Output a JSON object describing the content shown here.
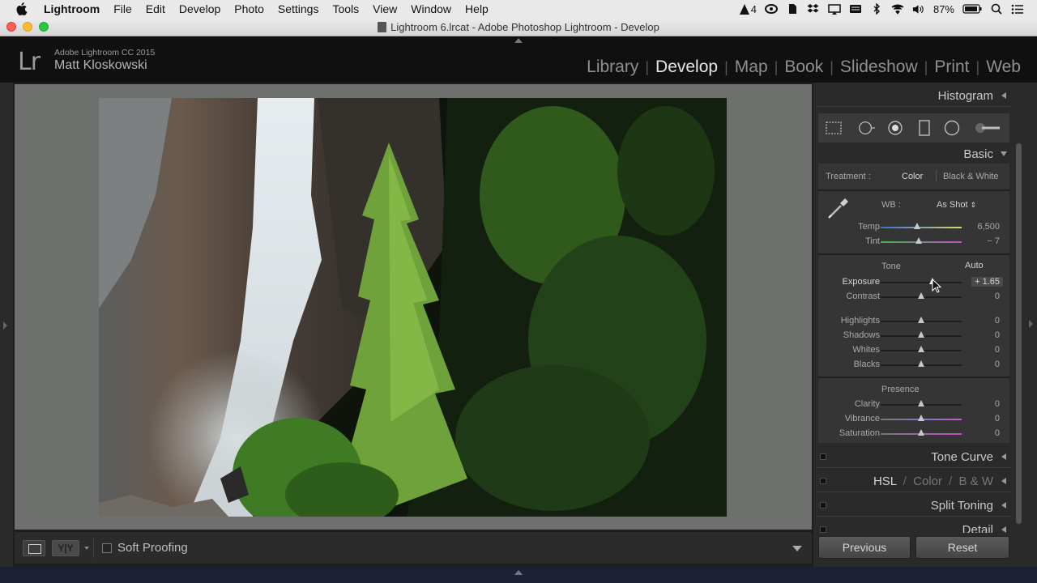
{
  "menubar": {
    "app_name": "Lightroom",
    "items": [
      "File",
      "Edit",
      "Develop",
      "Photo",
      "Settings",
      "Tools",
      "View",
      "Window",
      "Help"
    ],
    "status": {
      "badge_count": "4",
      "battery": "87%",
      "icons": [
        "adobe-cc-icon",
        "creative-cloud-icon",
        "evernote-icon",
        "dropbox-icon",
        "airplay-icon",
        "keyboard-icon",
        "bluetooth-icon",
        "wifi-icon",
        "volume-icon",
        "battery-icon",
        "spotlight-icon",
        "notification-center-icon"
      ]
    }
  },
  "window": {
    "title": "Lightroom 6.lrcat - Adobe Photoshop Lightroom - Develop"
  },
  "identity": {
    "logo": "Lr",
    "product": "Adobe Lightroom CC 2015",
    "user": "Matt Kloskowski"
  },
  "modules": {
    "items": [
      "Library",
      "Develop",
      "Map",
      "Book",
      "Slideshow",
      "Print",
      "Web"
    ],
    "active": "Develop"
  },
  "toolbar": {
    "soft_proofing_label": "Soft Proofing",
    "yy_label": "Y|Y"
  },
  "panels": {
    "histogram": "Histogram",
    "basic": "Basic",
    "tone_curve": "Tone Curve",
    "hsl": {
      "hsl": "HSL",
      "color": "Color",
      "bw": "B & W",
      "slash": "/"
    },
    "split_toning": "Split Toning",
    "detail": "Detail"
  },
  "basic": {
    "treatment_label": "Treatment :",
    "treatment_color": "Color",
    "treatment_bw": "Black & White",
    "wb_label": "WB :",
    "wb_value": "As Shot",
    "tone_label": "Tone",
    "auto_label": "Auto",
    "presence_label": "Presence",
    "sliders": {
      "temp": {
        "label": "Temp",
        "value": "6,500",
        "position": 0.45
      },
      "tint": {
        "label": "Tint",
        "value": "− 7",
        "position": 0.47
      },
      "exposure": {
        "label": "Exposure",
        "value": "+ 1.65",
        "position": 0.64
      },
      "contrast": {
        "label": "Contrast",
        "value": "0",
        "position": 0.5
      },
      "highlights": {
        "label": "Highlights",
        "value": "0",
        "position": 0.5
      },
      "shadows": {
        "label": "Shadows",
        "value": "0",
        "position": 0.5
      },
      "whites": {
        "label": "Whites",
        "value": "0",
        "position": 0.5
      },
      "blacks": {
        "label": "Blacks",
        "value": "0",
        "position": 0.5
      },
      "clarity": {
        "label": "Clarity",
        "value": "0",
        "position": 0.5
      },
      "vibrance": {
        "label": "Vibrance",
        "value": "0",
        "position": 0.5
      },
      "saturation": {
        "label": "Saturation",
        "value": "0",
        "position": 0.5
      }
    }
  },
  "buttons": {
    "previous": "Previous",
    "reset": "Reset"
  },
  "colors": {
    "canvas_bg": "#6e706e",
    "panel_bg": "#2a2a2a",
    "active_module": "#e6e6e6"
  }
}
